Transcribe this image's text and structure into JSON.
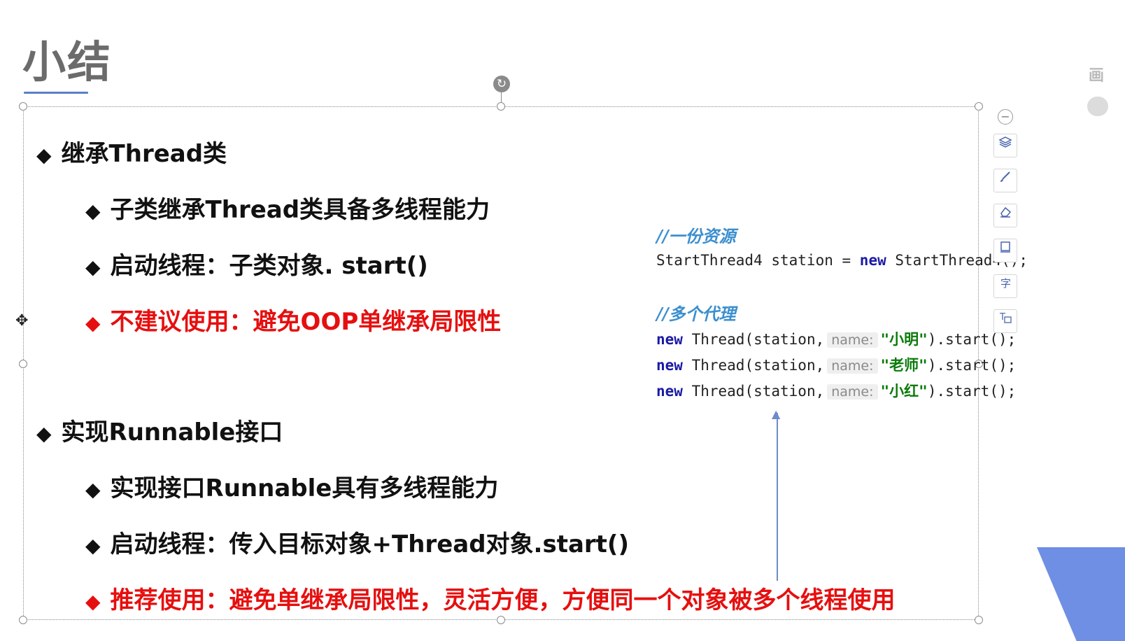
{
  "title": "小结",
  "sections": [
    {
      "main": "继承Thread类",
      "subs": [
        {
          "text": "子类继承Thread类具备多线程能力",
          "color": "#111111"
        },
        {
          "text": "启动线程：子类对象. start()",
          "color": "#111111"
        },
        {
          "text": "不建议使用：避免OOP单继承局限性",
          "color": "#e60f0f"
        }
      ]
    },
    {
      "main": "实现Runnable接口",
      "subs": [
        {
          "text": "实现接口Runnable具有多线程能力",
          "color": "#111111"
        },
        {
          "text": "启动线程：传入目标对象+Thread对象.start()",
          "color": "#111111"
        },
        {
          "text": "推荐使用：避免单继承局限性，灵活方便，方便同一个对象被多个线程使用",
          "color": "#e60f0f"
        }
      ]
    }
  ],
  "bullet_glyph": "◆",
  "code": {
    "comment1": "//一份资源",
    "line1_a": "StartThread4 station = ",
    "line1_kw": "new",
    "line1_b": " StartThread4();",
    "comment2": "//多个代理",
    "kw_new": "new",
    "thread_call": " Thread(station,",
    "hint": "name:",
    "names": [
      "\"小明\"",
      "\"老师\"",
      "\"小红\""
    ],
    "tail": ").start();"
  },
  "toolbar": {
    "minus": "−",
    "icons": [
      "layers-icon",
      "brush-icon",
      "eraser-icon",
      "frame-icon",
      "text-style-icon",
      "text-box-icon"
    ]
  },
  "edge_text": "画"
}
